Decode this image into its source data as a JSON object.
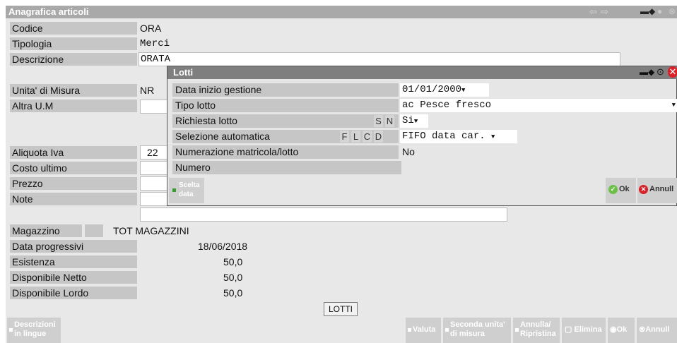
{
  "window": {
    "title": "Anagrafica articoli"
  },
  "form": {
    "codice": {
      "label": "Codice",
      "value": "ORA"
    },
    "tipologia": {
      "label": "Tipologia",
      "value": "Merci"
    },
    "descrizione": {
      "label": "Descrizione",
      "value": "ORATA"
    },
    "unita_misura": {
      "label": "Unita' di Misura",
      "value": "NR"
    },
    "altra_um": {
      "label": "Altra U.M",
      "value": ""
    },
    "aliquota_iva": {
      "label": "Aliquota Iva",
      "value": "22"
    },
    "costo_ultimo": {
      "label": "Costo ultimo",
      "value": ""
    },
    "prezzo": {
      "label": "Prezzo",
      "value": ""
    },
    "note": {
      "label": "Note",
      "value": ""
    }
  },
  "magazzino": {
    "label": "Magazzino",
    "value": "TOT MAGAZZINI",
    "rows": [
      {
        "label": "Data progressivi",
        "value": "18/06/2018"
      },
      {
        "label": "Esistenza",
        "value": "50,0"
      },
      {
        "label": "Disponibile Netto",
        "value": "50,0"
      },
      {
        "label": "Disponibile Lordo",
        "value": "50,0"
      }
    ],
    "lotti_button": "LOTTI"
  },
  "toolbar": {
    "descrizioni": [
      "Descrizioni",
      "in lingue"
    ],
    "valuta": "Valuta",
    "seconda": [
      "Seconda unita'",
      "di misura"
    ],
    "annulla_ripristina": [
      "Annulla/",
      "Ripristina"
    ],
    "elimina": "Elimina",
    "ok": "Ok",
    "annulla": "Annull"
  },
  "lotti": {
    "title": "Lotti",
    "data_inizio": {
      "label": "Data inizio gestione",
      "value": "01/01/2000"
    },
    "tipo_lotto": {
      "label": "Tipo lotto",
      "value": "ac Pesce fresco"
    },
    "richiesta": {
      "label": "Richiesta lotto",
      "options": [
        "S",
        "N"
      ],
      "value": "Si"
    },
    "selezione": {
      "label": "Selezione automatica",
      "options": [
        "F",
        "L",
        "C",
        "D"
      ],
      "value": "FIFO data car."
    },
    "numerazione": {
      "label": "Numerazione matricola/lotto",
      "value": "No"
    },
    "numero": {
      "label": "Numero",
      "value": ""
    },
    "scelta_data": [
      "Scelta",
      "data"
    ],
    "ok_label": "Ok",
    "annulla_label": "Annull"
  },
  "colors": {
    "title_bg": "#a9a9a9",
    "popup_title_bg": "#7f7f7f",
    "label_bg": "#c6c6c6",
    "ok": "#6cc04a",
    "cancel": "#d8232a"
  }
}
